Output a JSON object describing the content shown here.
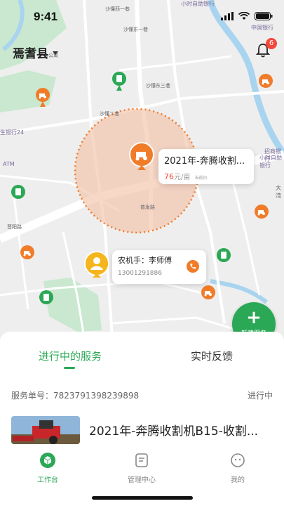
{
  "status_bar": {
    "time": "9:41"
  },
  "map": {
    "region": "焉耆县",
    "notification_count": "6",
    "street_labels": [
      "沙懂西一巷",
      "沙懂东一巷",
      "沙懂二巷",
      "沙懂东三巷",
      "小时自助银行",
      "中国银行",
      "招商银行",
      "小时自助银行",
      "生银行24",
      "ATM",
      "晋阳路",
      "工会公寓",
      "大湾",
      "普发路"
    ]
  },
  "service_card": {
    "title": "2021年-奔腾收割...",
    "price": "76",
    "price_unit": "元/亩",
    "price_note": "当前价"
  },
  "operator_card": {
    "label": "农机手：李师傅",
    "phone": "13001291886"
  },
  "new_service": {
    "label": "新建服务"
  },
  "tabs": {
    "active": "进行中的服务",
    "inactive": "实时反馈"
  },
  "order": {
    "number_label": "服务单号：",
    "number": "7823791398239898",
    "status": "进行中",
    "title": "2021年-奔腾收割机B15-收割..."
  },
  "bottom_nav": [
    {
      "label": "工作台",
      "icon": "cube-icon",
      "active": true
    },
    {
      "label": "管理中心",
      "icon": "document-icon",
      "active": false
    },
    {
      "label": "我的",
      "icon": "face-icon",
      "active": false
    }
  ],
  "colors": {
    "accent": "#2ba856",
    "orange": "#f07c2a",
    "price": "#f04a3a",
    "badge": "#f5473b"
  }
}
